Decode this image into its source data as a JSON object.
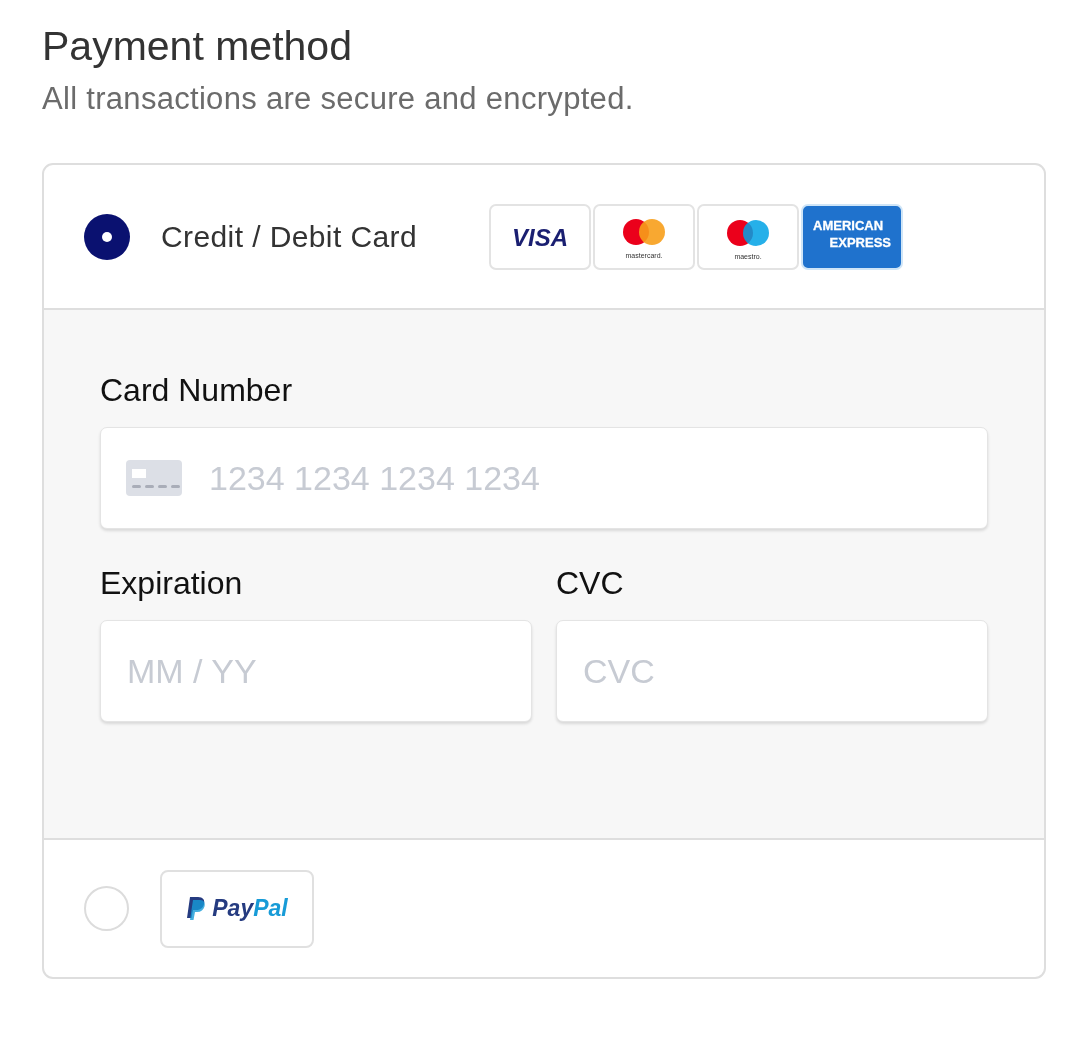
{
  "header": {
    "title": "Payment method",
    "subtitle": "All transactions are secure and encrypted."
  },
  "options": [
    {
      "kind": "card",
      "label": "Credit / Debit Card",
      "selected": true,
      "brands": [
        {
          "kind": "visa",
          "lines": [
            "VISA"
          ]
        },
        {
          "kind": "mastercard",
          "lines": [
            "mastercard."
          ]
        },
        {
          "kind": "maestro",
          "lines": [
            "maestro."
          ]
        },
        {
          "kind": "amex",
          "lines": [
            "AMERICAN",
            "EXPRESS"
          ]
        }
      ],
      "fields": [
        {
          "kind": "card-number",
          "label": "Card Number",
          "placeholder": "1234 1234 1234 1234"
        },
        {
          "kind": "expiry",
          "label": "Expiration",
          "placeholder": "MM / YY"
        },
        {
          "kind": "cvc",
          "label": "CVC",
          "placeholder": "CVC"
        }
      ]
    },
    {
      "kind": "paypal",
      "selected": false,
      "logo_parts": [
        "Pay",
        "Pal"
      ]
    }
  ]
}
